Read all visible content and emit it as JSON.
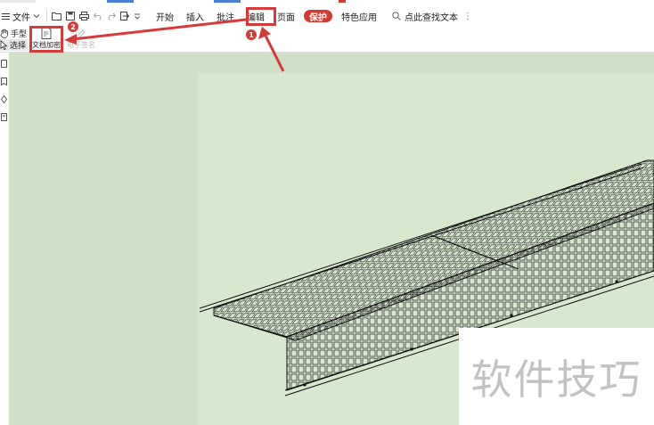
{
  "menubar": {
    "file_label": "文件",
    "tabs": [
      {
        "label": "开始",
        "active": false
      },
      {
        "label": "插入",
        "active": false
      },
      {
        "label": "批注",
        "active": false
      },
      {
        "label": "编辑",
        "active": false
      },
      {
        "label": "页面",
        "active": false
      },
      {
        "label": "保护",
        "active": true
      },
      {
        "label": "特色应用",
        "active": false
      }
    ],
    "search_label": "点此查找文本",
    "quick_icons": [
      "open-folder-icon",
      "save-icon",
      "print-icon",
      "undo-icon",
      "redo-icon",
      "export-icon",
      "customize-icon"
    ]
  },
  "ribbon": {
    "hand_tool": "手型",
    "select_tool": "选择",
    "encrypt_button": "文档加密",
    "sign_button": "电子签名"
  },
  "sidebar": {
    "icons": [
      "thumbnail-icon",
      "bookmark-icon",
      "annotation-icon",
      "attachment-icon"
    ]
  },
  "annotations": {
    "step1": "1",
    "step2": "2",
    "color": "#d83a3a"
  },
  "watermark": {
    "text": "软件技巧"
  },
  "colors": {
    "active_tab": "#d33a30",
    "document_background": "#cfe0c6",
    "page_background": "#d7e8cf"
  }
}
